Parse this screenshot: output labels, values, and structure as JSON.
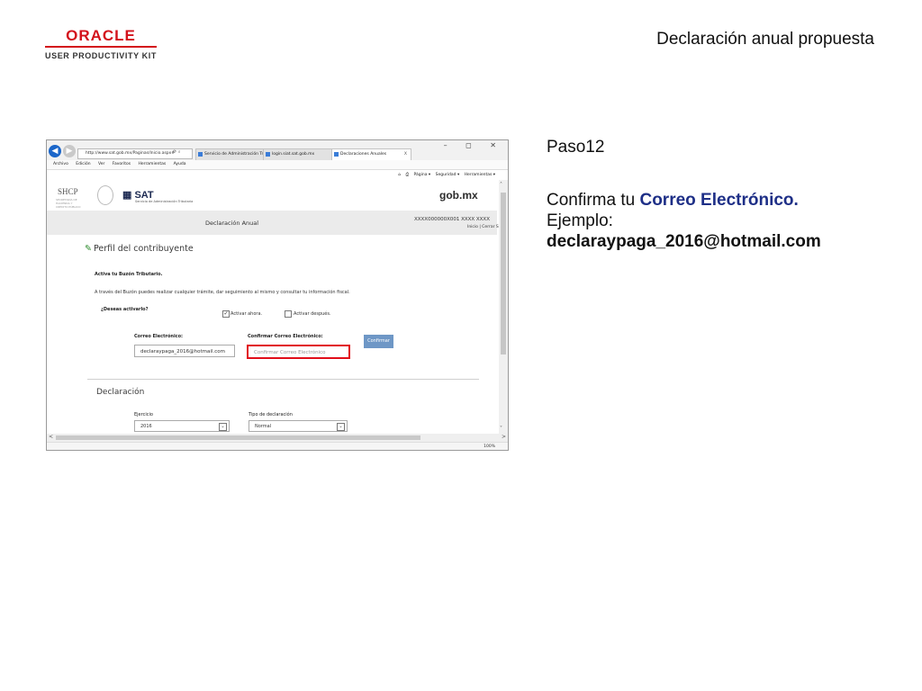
{
  "slide": {
    "brand": {
      "oracle": "ORACLE",
      "product": "USER PRODUCTIVITY KIT"
    },
    "title": "Declaración anual propuesta",
    "step": "Paso12",
    "instruction": {
      "prefix": "Confirma tu ",
      "field": "Correo Electrónico.",
      "example_label": "Ejemplo:",
      "example_value": "declaraypaga_2016@hotmail.com"
    }
  },
  "browser": {
    "url": "http://www.sat.gob.mx/Paginas/Inicio.aspx#",
    "window_controls": "–  ◻  ✕",
    "tabs": [
      {
        "label": "Servicio de Administración Tri..."
      },
      {
        "label": "login.siat.sat.gob.mx"
      },
      {
        "label": "Declaraciones Anuales",
        "close": "X"
      }
    ],
    "menu": [
      "Archivo",
      "Edición",
      "Ver",
      "Favoritos",
      "Herramientas",
      "Ayuda"
    ],
    "commands": [
      "Página ▾",
      "Seguridad ▾",
      "Herramientas ▾"
    ],
    "zoom": "100%"
  },
  "site": {
    "shcp": "SHCP",
    "shcp_sub": "SECRETARÍA DE HACIENDA Y CRÉDITO PÚBLICO",
    "sat": "SAT",
    "sat_sub": "Servicio de Administración Tributaria",
    "gobmx": "gob.mx",
    "section_title": "Declaración Anual",
    "rfc": "XXXX000000X001  XXXX XXXX",
    "links": "Inicio | Cerrar Sesió"
  },
  "form": {
    "perfil_heading": "Perfil del contribuyente",
    "activa": "Activa tu Buzón Tributario.",
    "description": "A través del Buzón puedes realizar cualquier trámite, dar seguimiento al mismo y consultar tu información fiscal.",
    "question": "¿Deseas activarlo?",
    "option_now": "Activar ahora.",
    "option_later": "Activar después.",
    "correo_label": "Correo Electrónico:",
    "correo_value": "declaraypaga_2016@hotmail.com",
    "confirmar_label": "Confirmar Correo Electrónico:",
    "confirmar_placeholder": "Confirmar Correo Electrónico",
    "confirm_button": "Confirmar",
    "declaracion_heading": "Declaración",
    "ejercicio_label": "Ejercicio",
    "ejercicio_value": "2016",
    "tipo_label": "Tipo de declaración",
    "tipo_value": "Normal"
  },
  "colors": {
    "oracle_red": "#d3111b",
    "highlight_red": "#e10e1a",
    "field_name_blue": "#1e2f87",
    "button_blue": "#6e97c6"
  }
}
